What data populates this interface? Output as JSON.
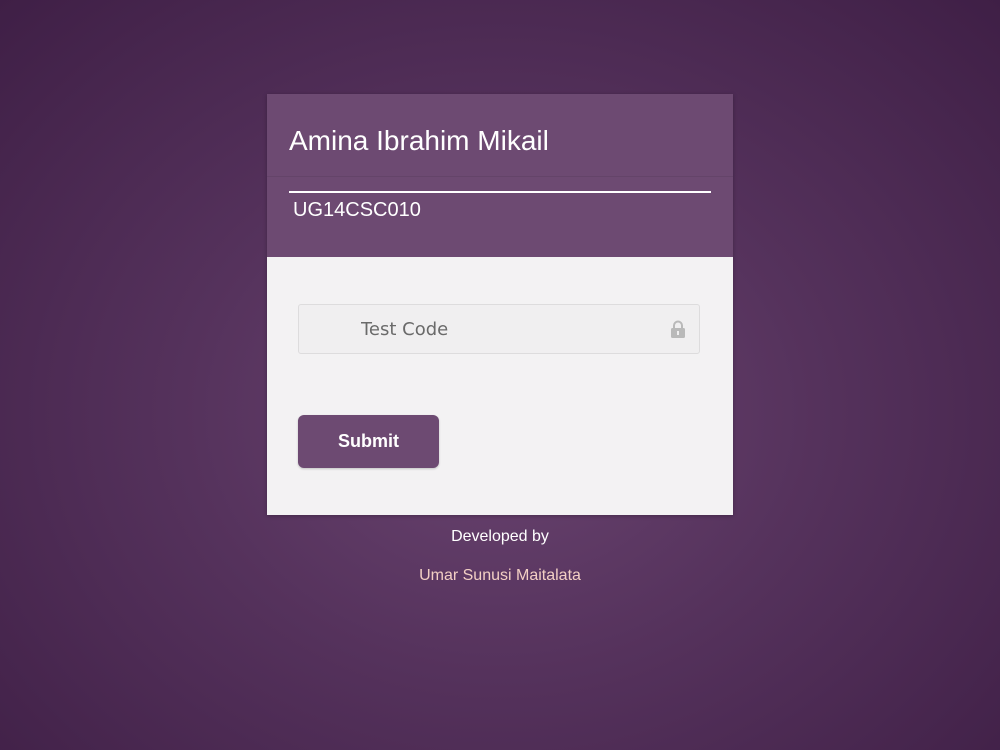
{
  "header": {
    "student_name": "Amina Ibrahim Mikail",
    "student_id": "UG14CSC010"
  },
  "form": {
    "test_code_value": "",
    "test_code_placeholder": "Test Code",
    "lock_icon": "lock-icon",
    "submit_label": "Submit"
  },
  "footer": {
    "developed_by_label": "Developed by",
    "author": "Umar Sunusi Maitalata"
  },
  "colors": {
    "header_bg": "#6d4a72",
    "body_bg": "#f3f2f3",
    "page_bg": "#4e2c55",
    "author_text": "#f2cfc4"
  }
}
